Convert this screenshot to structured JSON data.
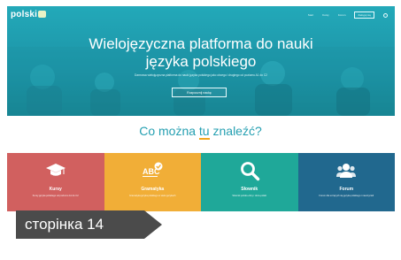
{
  "header": {
    "logo": "polski",
    "nav": [
      "Start",
      "Kursy",
      "Forum",
      "Zaloguj się"
    ]
  },
  "hero": {
    "title_line1": "Wielojęzyczna platforma do nauki",
    "title_line2": "języka polskiego",
    "subtitle": "Darmowa wielojęzyczna platforma do nauki języka polskiego jako obcego i drugiego od poziomu A1 do C2",
    "button": "Rozpocznij naukę"
  },
  "section": {
    "title_before": "Co można ",
    "title_highlight": "tu",
    "title_after": " znaleźć?"
  },
  "tiles": [
    {
      "name": "Kursy",
      "desc": "Kursy języka polskiego od poziomu A1 do C2",
      "color": "#d1605f",
      "icon": "graduation-cap-icon"
    },
    {
      "name": "Gramatyka",
      "desc": "Gramatyka języka polskiego w wielu językach",
      "color": "#f1ae37",
      "icon": "abc-check-icon"
    },
    {
      "name": "Słownik",
      "desc": "Słownik polsko-obcy i obco-polski",
      "color": "#1fa899",
      "icon": "search-icon"
    },
    {
      "name": "Forum",
      "desc": "Forum dla uczących się języka polskiego i nauczycieli",
      "color": "#21688e",
      "icon": "people-icon"
    }
  ],
  "page_label": "сторінка 14",
  "colors": {
    "hero": "#1f9fb0",
    "accent_title": "#249fb1",
    "underline": "#f3a51b",
    "label_bg": "#4b4b4b"
  }
}
